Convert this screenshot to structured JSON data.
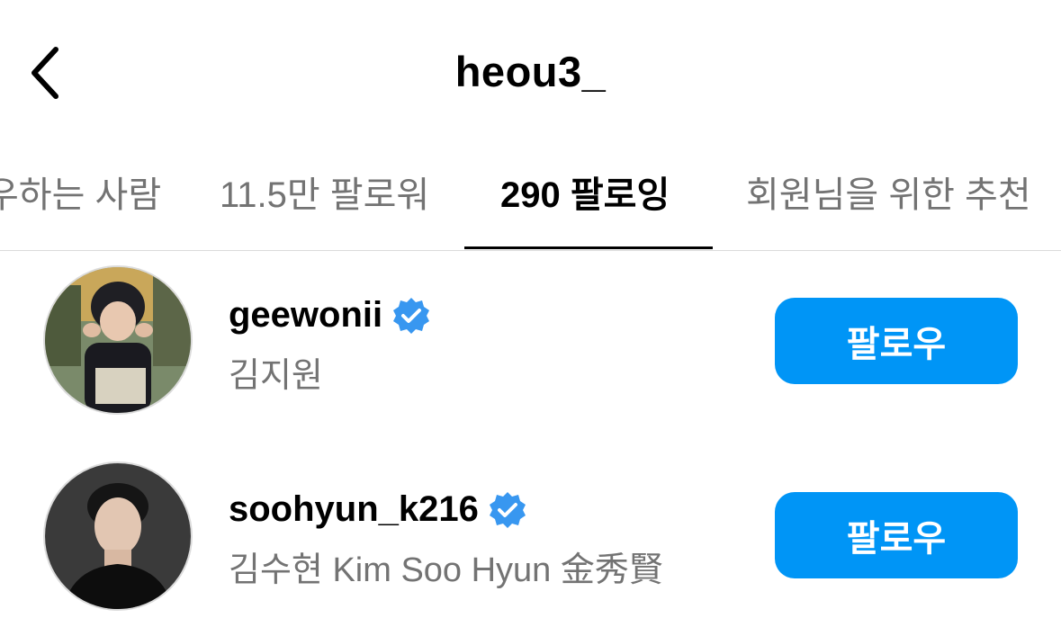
{
  "header": {
    "title": "heou3_",
    "back_icon": "chevron-left-icon"
  },
  "tabs": [
    {
      "label": "우하는 사람",
      "active": false
    },
    {
      "label": "11.5만 팔로워",
      "active": false
    },
    {
      "label": "290 팔로잉",
      "active": true
    },
    {
      "label": "회원님을 위한 추천",
      "active": false
    }
  ],
  "accounts": [
    {
      "username": "geewonii",
      "full_name": "김지원",
      "verified": true,
      "button_label": "팔로우"
    },
    {
      "username": "soohyun_k216",
      "full_name": "김수현 Kim Soo Hyun 金秀賢",
      "verified": true,
      "button_label": "팔로우"
    }
  ],
  "colors": {
    "accent": "#0095f6",
    "verified": "#3897f0",
    "secondary_text": "#737373",
    "divider": "#dbdbdb"
  }
}
